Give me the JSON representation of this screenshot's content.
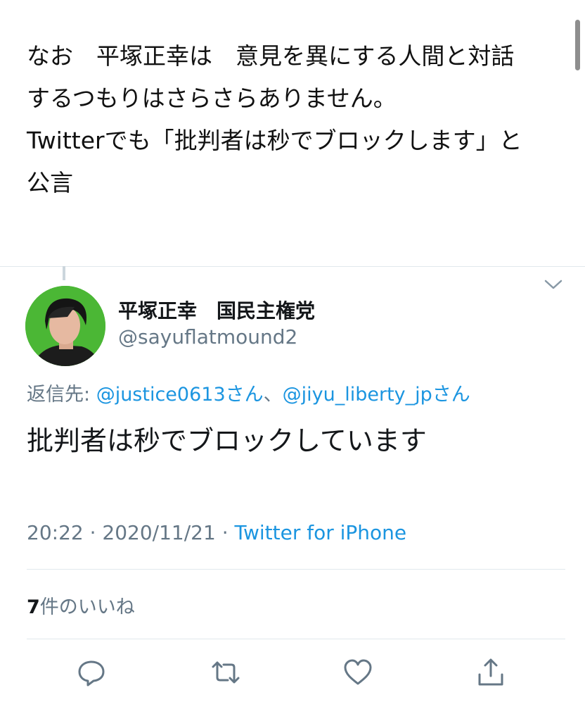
{
  "intro": {
    "lines": [
      "なお　平塚正幸は　意見を異にする人間と対話",
      "するつもりはさらさらありません。",
      "Twitterでも「批判者は秒でブロックします」と",
      "公言"
    ]
  },
  "tweet": {
    "display_name": "平塚正幸　国民主権党",
    "handle": "@sayuflatmound2",
    "reply_prefix": "返信先: ",
    "reply_to_1": "@justice0613さん",
    "reply_sep": "、",
    "reply_to_2": "@jiyu_liberty_jpさん",
    "text": "批判者は秒でブロックしています",
    "time": "20:22",
    "dot": " · ",
    "date": "2020/11/21",
    "source": "Twitter for iPhone",
    "likes_count": "7",
    "likes_label": "件のいいね"
  },
  "icons": {
    "reply": "reply-icon",
    "retweet": "retweet-icon",
    "like": "heart-icon",
    "share": "share-icon",
    "caret": "chevron-down-icon"
  },
  "colors": {
    "link": "#1b95e0",
    "secondary": "#657786",
    "avatar_bg": "#4bb735"
  }
}
